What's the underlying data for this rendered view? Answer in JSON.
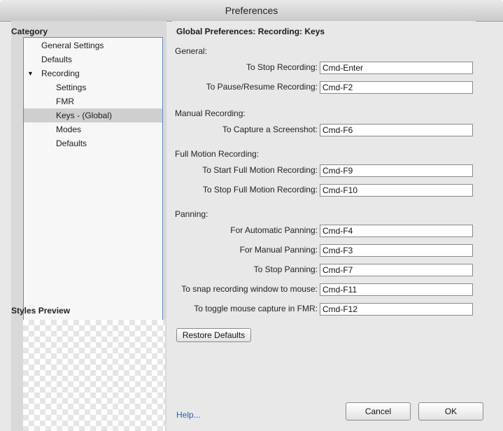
{
  "window": {
    "title": "Preferences"
  },
  "left": {
    "category_label": "Category",
    "items": [
      {
        "label": "General Settings",
        "indent": 1,
        "selected": false
      },
      {
        "label": "Defaults",
        "indent": 1,
        "selected": false
      },
      {
        "label": "Recording",
        "indent": 1,
        "selected": false,
        "expanded": true,
        "arrow": "▼"
      },
      {
        "label": "Settings",
        "indent": 2,
        "selected": false
      },
      {
        "label": "FMR",
        "indent": 2,
        "selected": false
      },
      {
        "label": "Keys - (Global)",
        "indent": 2,
        "selected": true
      },
      {
        "label": "Modes",
        "indent": 2,
        "selected": false
      },
      {
        "label": "Defaults",
        "indent": 2,
        "selected": false
      }
    ],
    "styles_preview_label": "Styles Preview"
  },
  "main": {
    "heading": "Global Preferences: Recording: Keys",
    "sections": [
      {
        "title": "General:",
        "rows": [
          {
            "label": "To Stop Recording:",
            "value": "Cmd-Enter"
          },
          {
            "label": "To Pause/Resume Recording:",
            "value": "Cmd-F2"
          }
        ]
      },
      {
        "title": "Manual Recording:",
        "rows": [
          {
            "label": "To Capture a Screenshot:",
            "value": "Cmd-F6"
          }
        ]
      },
      {
        "title": "Full Motion Recording:",
        "rows": [
          {
            "label": "To Start Full Motion Recording:",
            "value": "Cmd-F9"
          },
          {
            "label": "To Stop Full Motion Recording:",
            "value": "Cmd-F10"
          }
        ]
      },
      {
        "title": "Panning:",
        "rows": [
          {
            "label": "For Automatic Panning:",
            "value": "Cmd-F4"
          },
          {
            "label": "For Manual Panning:",
            "value": "Cmd-F3"
          },
          {
            "label": "To Stop Panning:",
            "value": "Cmd-F7"
          },
          {
            "label": "To snap recording window to mouse:",
            "value": "Cmd-F11"
          },
          {
            "label": "To toggle mouse capture in FMR:",
            "value": "Cmd-F12"
          }
        ]
      }
    ],
    "restore_label": "Restore Defaults",
    "help_label": "Help...",
    "cancel_label": "Cancel",
    "ok_label": "OK"
  }
}
